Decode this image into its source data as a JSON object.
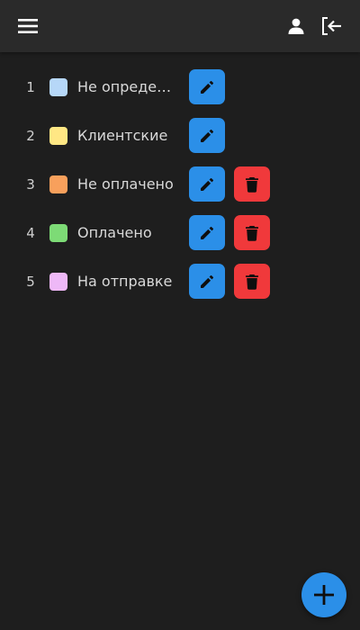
{
  "header": {
    "menu_icon": "hamburger-menu-icon",
    "user_icon": "user-icon",
    "logout_icon": "logout-icon"
  },
  "statuses": [
    {
      "index": "1",
      "label": "Не определе…",
      "color": "#b6d7f8",
      "edit_icon": "pencil-icon",
      "can_delete": false
    },
    {
      "index": "2",
      "label": "Клиентские",
      "color": "#ffe784",
      "edit_icon": "pencil-icon",
      "can_delete": false
    },
    {
      "index": "3",
      "label": "Не оплачено",
      "color": "#f8a05c",
      "edit_icon": "pencil-icon",
      "can_delete": true,
      "delete_icon": "trash-icon"
    },
    {
      "index": "4",
      "label": "Оплачено",
      "color": "#7ddb76",
      "edit_icon": "pencil-icon",
      "can_delete": true,
      "delete_icon": "trash-icon"
    },
    {
      "index": "5",
      "label": "На отправке",
      "color": "#eeb8f7",
      "edit_icon": "pencil-icon",
      "can_delete": true,
      "delete_icon": "trash-icon"
    }
  ],
  "fab": {
    "icon": "plus-icon"
  },
  "colors": {
    "background": "#1e1e1e",
    "topbar": "#2a2a2a",
    "edit": "#2b8fe8",
    "delete": "#f0393b"
  }
}
